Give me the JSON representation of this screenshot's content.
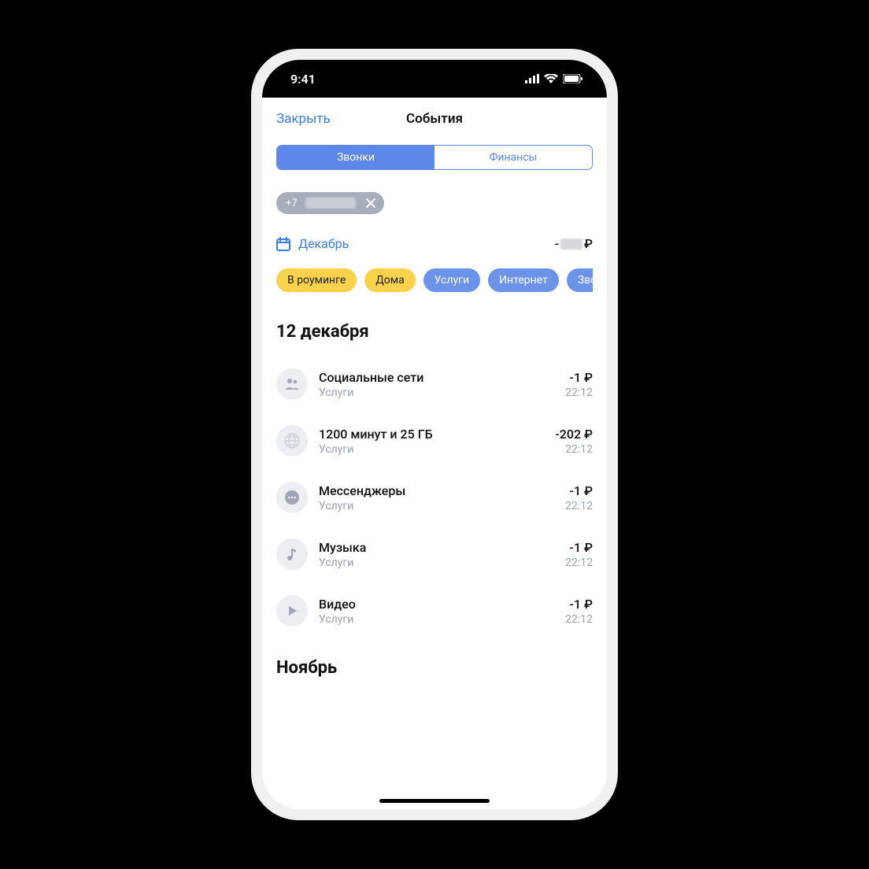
{
  "status": {
    "time": "9:41"
  },
  "nav": {
    "close": "Закрыть",
    "title": "События"
  },
  "segmented": {
    "calls": "Звонки",
    "finance": "Финансы"
  },
  "phoneChip": {
    "prefix": "+7"
  },
  "month": {
    "label": "Декабрь",
    "amountPrefix": "-",
    "currency": "₽"
  },
  "filterChips": [
    {
      "label": "В роуминге",
      "color": "yellow"
    },
    {
      "label": "Дома",
      "color": "yellow"
    },
    {
      "label": "Услуги",
      "color": "blue"
    },
    {
      "label": "Интернет",
      "color": "blue"
    },
    {
      "label": "Звонки",
      "color": "blue"
    }
  ],
  "section1": {
    "heading": "12 декабря"
  },
  "transactions": [
    {
      "icon": "people",
      "title": "Социальные сети",
      "category": "Услуги",
      "amount": "-1 ₽",
      "time": "22:12"
    },
    {
      "icon": "globe",
      "title": "1200 минут и 25 ГБ",
      "category": "Услуги",
      "amount": "-202 ₽",
      "time": "22:12"
    },
    {
      "icon": "chat",
      "title": "Мессенджеры",
      "category": "Услуги",
      "amount": "-1 ₽",
      "time": "22:12"
    },
    {
      "icon": "music",
      "title": "Музыка",
      "category": "Услуги",
      "amount": "-1 ₽",
      "time": "22:12"
    },
    {
      "icon": "play",
      "title": "Видео",
      "category": "Услуги",
      "amount": "-1 ₽",
      "time": "22:12"
    }
  ],
  "section2": {
    "heading": "Ноябрь"
  }
}
